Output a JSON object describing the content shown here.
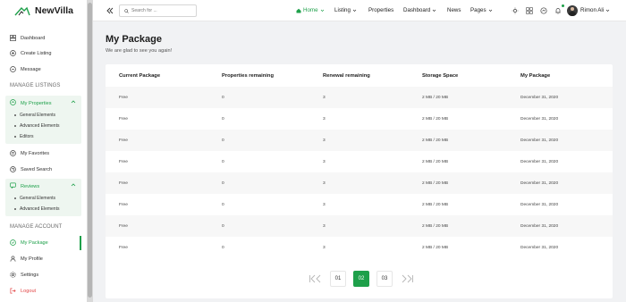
{
  "brand": {
    "name": "NewVilla",
    "accent": "#1ea04a"
  },
  "sidebar": {
    "top_items": [
      {
        "label": "Dashboard",
        "icon": "dashboard-icon"
      },
      {
        "label": "Create Listing",
        "icon": "plus-circle-icon"
      },
      {
        "label": "Message",
        "icon": "message-icon"
      }
    ],
    "manage_listings_label": "MANAGE LISTINGS",
    "my_properties": {
      "label": "My Properties",
      "subitems": [
        "General Elements",
        "Advanced Elements",
        "Editors"
      ]
    },
    "favorites_label": "My Favorites",
    "saved_search_label": "Saved Search",
    "reviews": {
      "label": "Reviews",
      "subitems": [
        "General Elements",
        "Advanced Elements"
      ]
    },
    "manage_account_label": "MANAGE ACCOUNT",
    "account_items": [
      {
        "label": "My Package",
        "icon": "package-icon",
        "active": true
      },
      {
        "label": "My Profile",
        "icon": "user-icon"
      },
      {
        "label": "Settings",
        "icon": "gear-icon"
      },
      {
        "label": "Logout",
        "icon": "logout-icon"
      }
    ]
  },
  "topbar": {
    "search_placeholder": "Search for ...",
    "menu": {
      "home": "Home",
      "listing": "Listing",
      "properties": "Properties",
      "dashboard": "Dashboard",
      "news": "News",
      "pages": "Pages"
    },
    "user_name": "Rimon Ali"
  },
  "page": {
    "title": "My Package",
    "subtitle": "We are glad to see you again!"
  },
  "table": {
    "headers": [
      "Current Package",
      "Properties remaining",
      "Renewal remaining",
      "Storage Space",
      "My Package"
    ],
    "rows": [
      [
        "Free",
        "0",
        "3",
        "2 MB / 20 MB",
        "December 31, 2020"
      ],
      [
        "Free",
        "0",
        "3",
        "2 MB / 20 MB",
        "December 31, 2020"
      ],
      [
        "Free",
        "0",
        "3",
        "2 MB / 20 MB",
        "December 31, 2020"
      ],
      [
        "Free",
        "0",
        "3",
        "2 MB / 20 MB",
        "December 31, 2020"
      ],
      [
        "Free",
        "0",
        "3",
        "2 MB / 20 MB",
        "December 31, 2020"
      ],
      [
        "Free",
        "0",
        "3",
        "2 MB / 20 MB",
        "December 31, 2020"
      ],
      [
        "Free",
        "0",
        "3",
        "2 MB / 20 MB",
        "December 31, 2020"
      ],
      [
        "Free",
        "0",
        "3",
        "2 MB / 20 MB",
        "December 31, 2020"
      ]
    ]
  },
  "pagination": {
    "pages": [
      "01",
      "02",
      "03"
    ],
    "current": "02"
  }
}
